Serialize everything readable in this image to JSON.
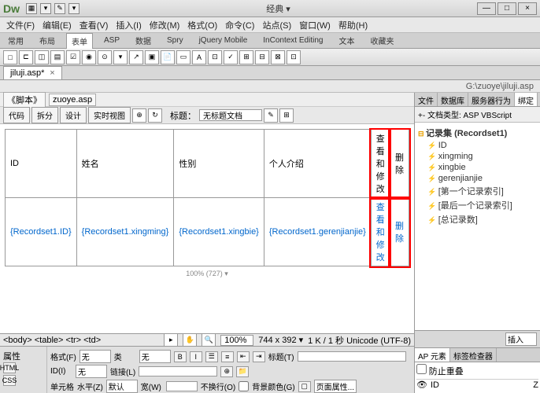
{
  "app": {
    "logo": "Dw",
    "title_mode": "经典 ▾"
  },
  "win": {
    "min": "—",
    "max": "□",
    "close": "×"
  },
  "menu": [
    "文件(F)",
    "编辑(E)",
    "查看(V)",
    "插入(I)",
    "修改(M)",
    "格式(O)",
    "命令(C)",
    "站点(S)",
    "窗口(W)",
    "帮助(H)"
  ],
  "tabs": [
    "常用",
    "布局",
    "表单",
    "ASP",
    "数据",
    "Spry",
    "jQuery Mobile",
    "InContext Editing",
    "文本",
    "收藏夹"
  ],
  "active_tab": "表单",
  "doc_tab": {
    "name": "jiluji.asp*",
    "close": "×"
  },
  "path": "G:\\zuoye\\jiluji.asp",
  "crumbs": [
    "《脚本》",
    "zuoye.asp"
  ],
  "view": {
    "btns": [
      "代码",
      "拆分",
      "设计",
      "实时视图"
    ],
    "title_label": "标题：",
    "title_value": "无标题文档"
  },
  "table": {
    "headers": [
      "ID",
      "姓名",
      "性别",
      "个人介绍",
      "查看和修改",
      "删除"
    ],
    "cells": [
      "{Recordset1.ID}",
      "{Recordset1.xingming}",
      "{Recordset1.xingbie}",
      "{Recordset1.gerenjianjie}",
      "查看和修改",
      "删除"
    ]
  },
  "ruler": "100% (727) ▾",
  "right": {
    "tabs": [
      "文件",
      "数据库",
      "服务器行为",
      "绑定"
    ],
    "doctype_head": "+- 文档类型: ASP VBScript",
    "tree_root": "记录集 (Recordset1)",
    "tree": [
      "ID",
      "xingming",
      "xingbie",
      "gerenjianjie",
      "[第一个记录索引]",
      "[最后一个记录索引]",
      "[总记录数]"
    ],
    "insert_btn": "插入",
    "ap_tabs": [
      "AP 元素",
      "标签检查器"
    ],
    "ap_check": "防止重叠",
    "ap_cols": [
      "ID",
      "",
      "Z"
    ]
  },
  "status": {
    "path": "<body> <table> <tr> <td>",
    "zoom": "100%",
    "dims": "744 x 392 ▾",
    "size": "1 K / 1 秒 Unicode (UTF-8)"
  },
  "props": {
    "title": "属性",
    "html": "HTML",
    "css": "CSS",
    "format_l": "格式(F)",
    "format_v": "无",
    "class_l": "类",
    "class_v": "无",
    "id_l": "ID(I)",
    "id_v": "无",
    "link_l": "链接(L)",
    "cell_l": "单元格",
    "halign_l": "水平(Z)",
    "halign_v": "默认",
    "width_l": "宽(W)",
    "nowrap_l": "不换行(O)",
    "bg_l": "背景颜色(G)",
    "page_l": "页面属性...",
    "title_attr_l": "标题(T)"
  }
}
